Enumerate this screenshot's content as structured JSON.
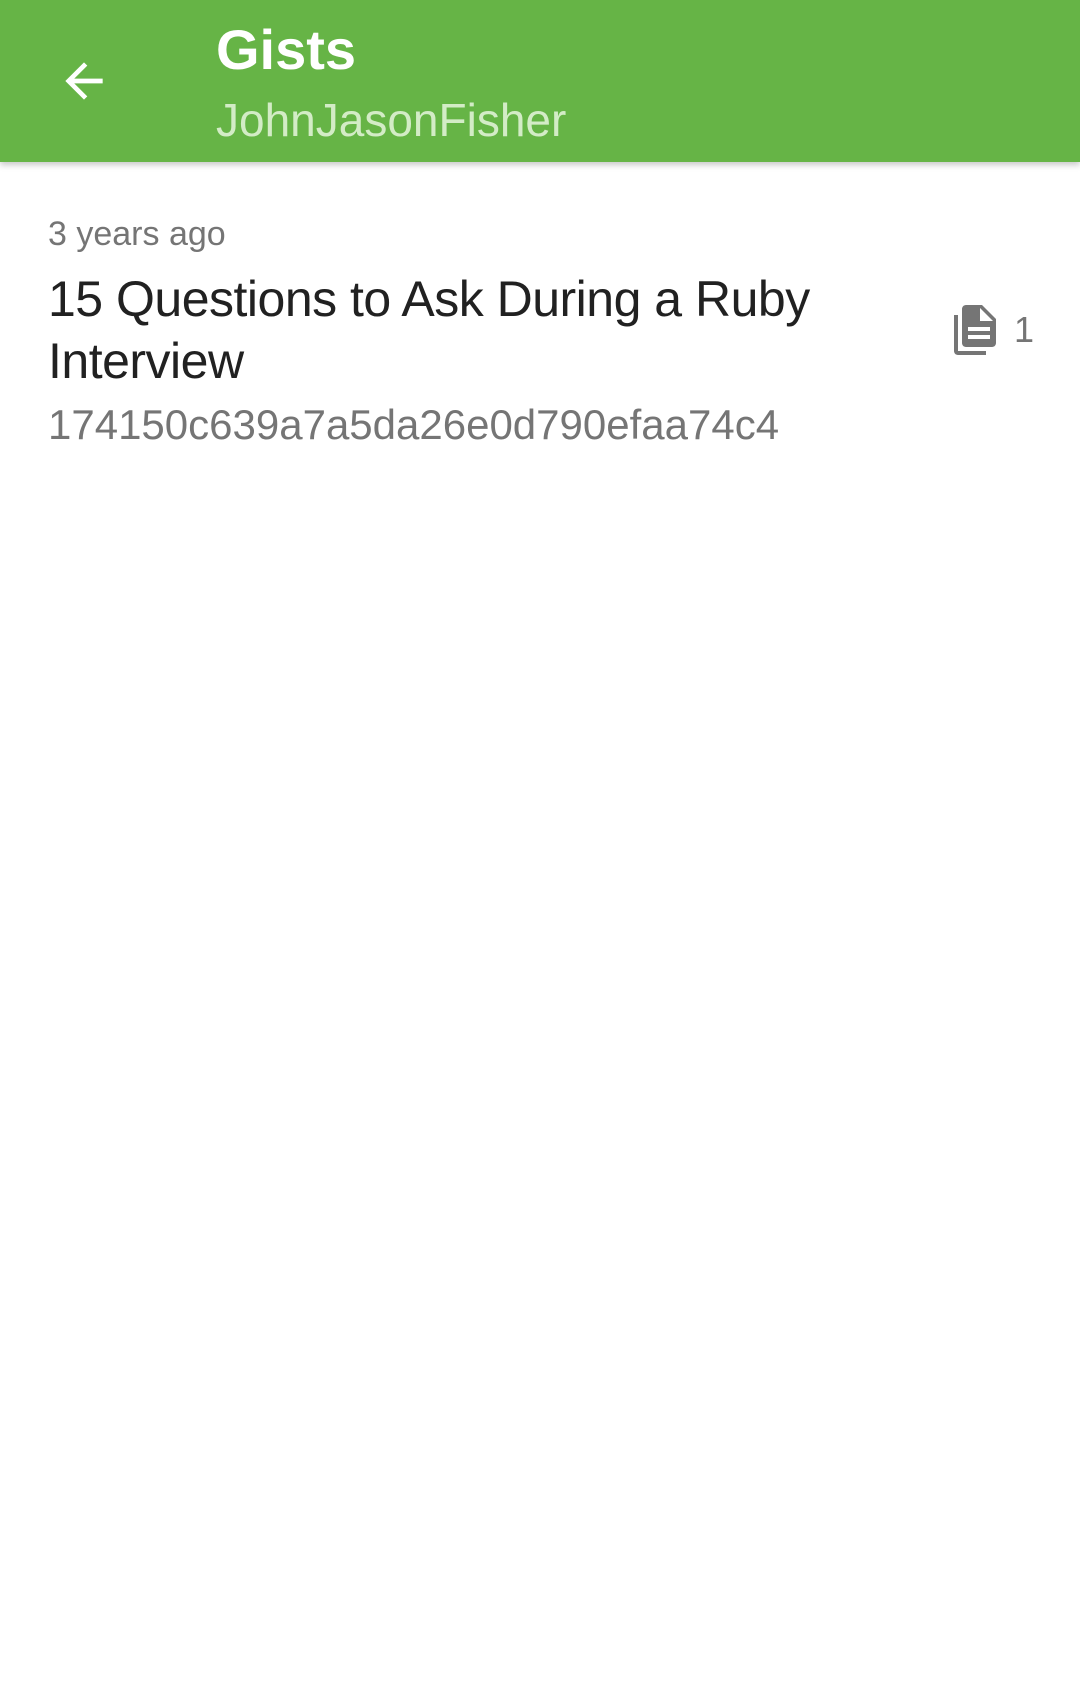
{
  "appbar": {
    "title": "Gists",
    "subtitle": "JohnJasonFisher",
    "back_icon": "arrow-left-icon",
    "color": "#66b446"
  },
  "gists": [
    {
      "time": "3 years ago",
      "title": "15 Questions to Ask During a Ruby Interview",
      "id": "174150c639a7a5da26e0d790efaa74c4",
      "files_icon": "file-copy-icon",
      "file_count": "1"
    }
  ]
}
